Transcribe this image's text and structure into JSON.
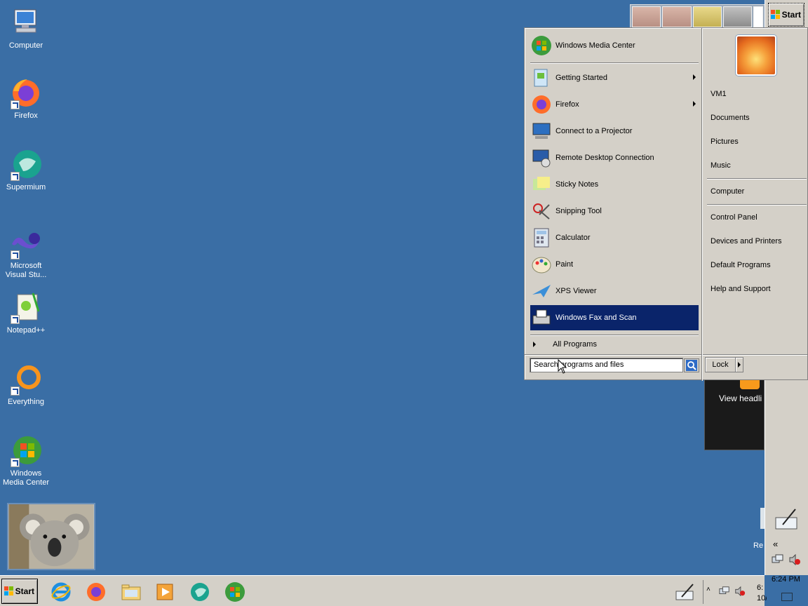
{
  "desktop": {
    "icons": [
      {
        "label": "Computer"
      },
      {
        "label": "Firefox"
      },
      {
        "label": "Supermium"
      },
      {
        "label": "Microsoft Visual Stu..."
      },
      {
        "label": "Notepad++"
      },
      {
        "label": "Everything"
      },
      {
        "label": "Windows Media Center"
      }
    ],
    "gadget_text": "View headli",
    "recycle_partial": "Re"
  },
  "start_menu": {
    "pinned": [
      {
        "label": "Windows Media Center",
        "icon": "windows-media-center-icon"
      }
    ],
    "recent": [
      {
        "label": "Getting Started",
        "icon": "getting-started-icon",
        "submenu": true
      },
      {
        "label": "Firefox",
        "icon": "firefox-icon",
        "submenu": true
      },
      {
        "label": "Connect to a Projector",
        "icon": "projector-icon",
        "submenu": false
      },
      {
        "label": "Remote Desktop Connection",
        "icon": "remote-desktop-icon",
        "submenu": false
      },
      {
        "label": "Sticky Notes",
        "icon": "sticky-notes-icon",
        "submenu": false
      },
      {
        "label": "Snipping Tool",
        "icon": "snipping-tool-icon",
        "submenu": false
      },
      {
        "label": "Calculator",
        "icon": "calculator-icon",
        "submenu": false
      },
      {
        "label": "Paint",
        "icon": "paint-icon",
        "submenu": false
      },
      {
        "label": "XPS Viewer",
        "icon": "xps-viewer-icon",
        "submenu": false
      },
      {
        "label": "Windows Fax and Scan",
        "icon": "fax-scan-icon",
        "submenu": false,
        "selected": true
      }
    ],
    "all_programs": "All Programs",
    "search_placeholder": "Search programs and files",
    "right": [
      {
        "label": "VM1"
      },
      {
        "label": "Documents"
      },
      {
        "label": "Pictures"
      },
      {
        "label": "Music"
      },
      {
        "label": "Computer"
      },
      {
        "label": "Control Panel"
      },
      {
        "label": "Devices and Printers"
      },
      {
        "label": "Default Programs"
      },
      {
        "label": "Help and Support"
      }
    ],
    "lock_label": "Lock"
  },
  "taskbar": {
    "start_label": "Start",
    "icons": [
      "internet-explorer-icon",
      "firefox-icon",
      "file-explorer-icon",
      "media-player-icon",
      "supermium-icon",
      "windows-media-center-icon"
    ],
    "tray_time_partial": "6:",
    "tray_date_partial": "10/"
  },
  "sidebar": {
    "start_label": "Start",
    "clock": "6:24 PM",
    "chevron": "«"
  },
  "colors": {
    "desktop": "#3a6ea5",
    "selection": "#0a246a",
    "face": "#d4d0c8"
  }
}
